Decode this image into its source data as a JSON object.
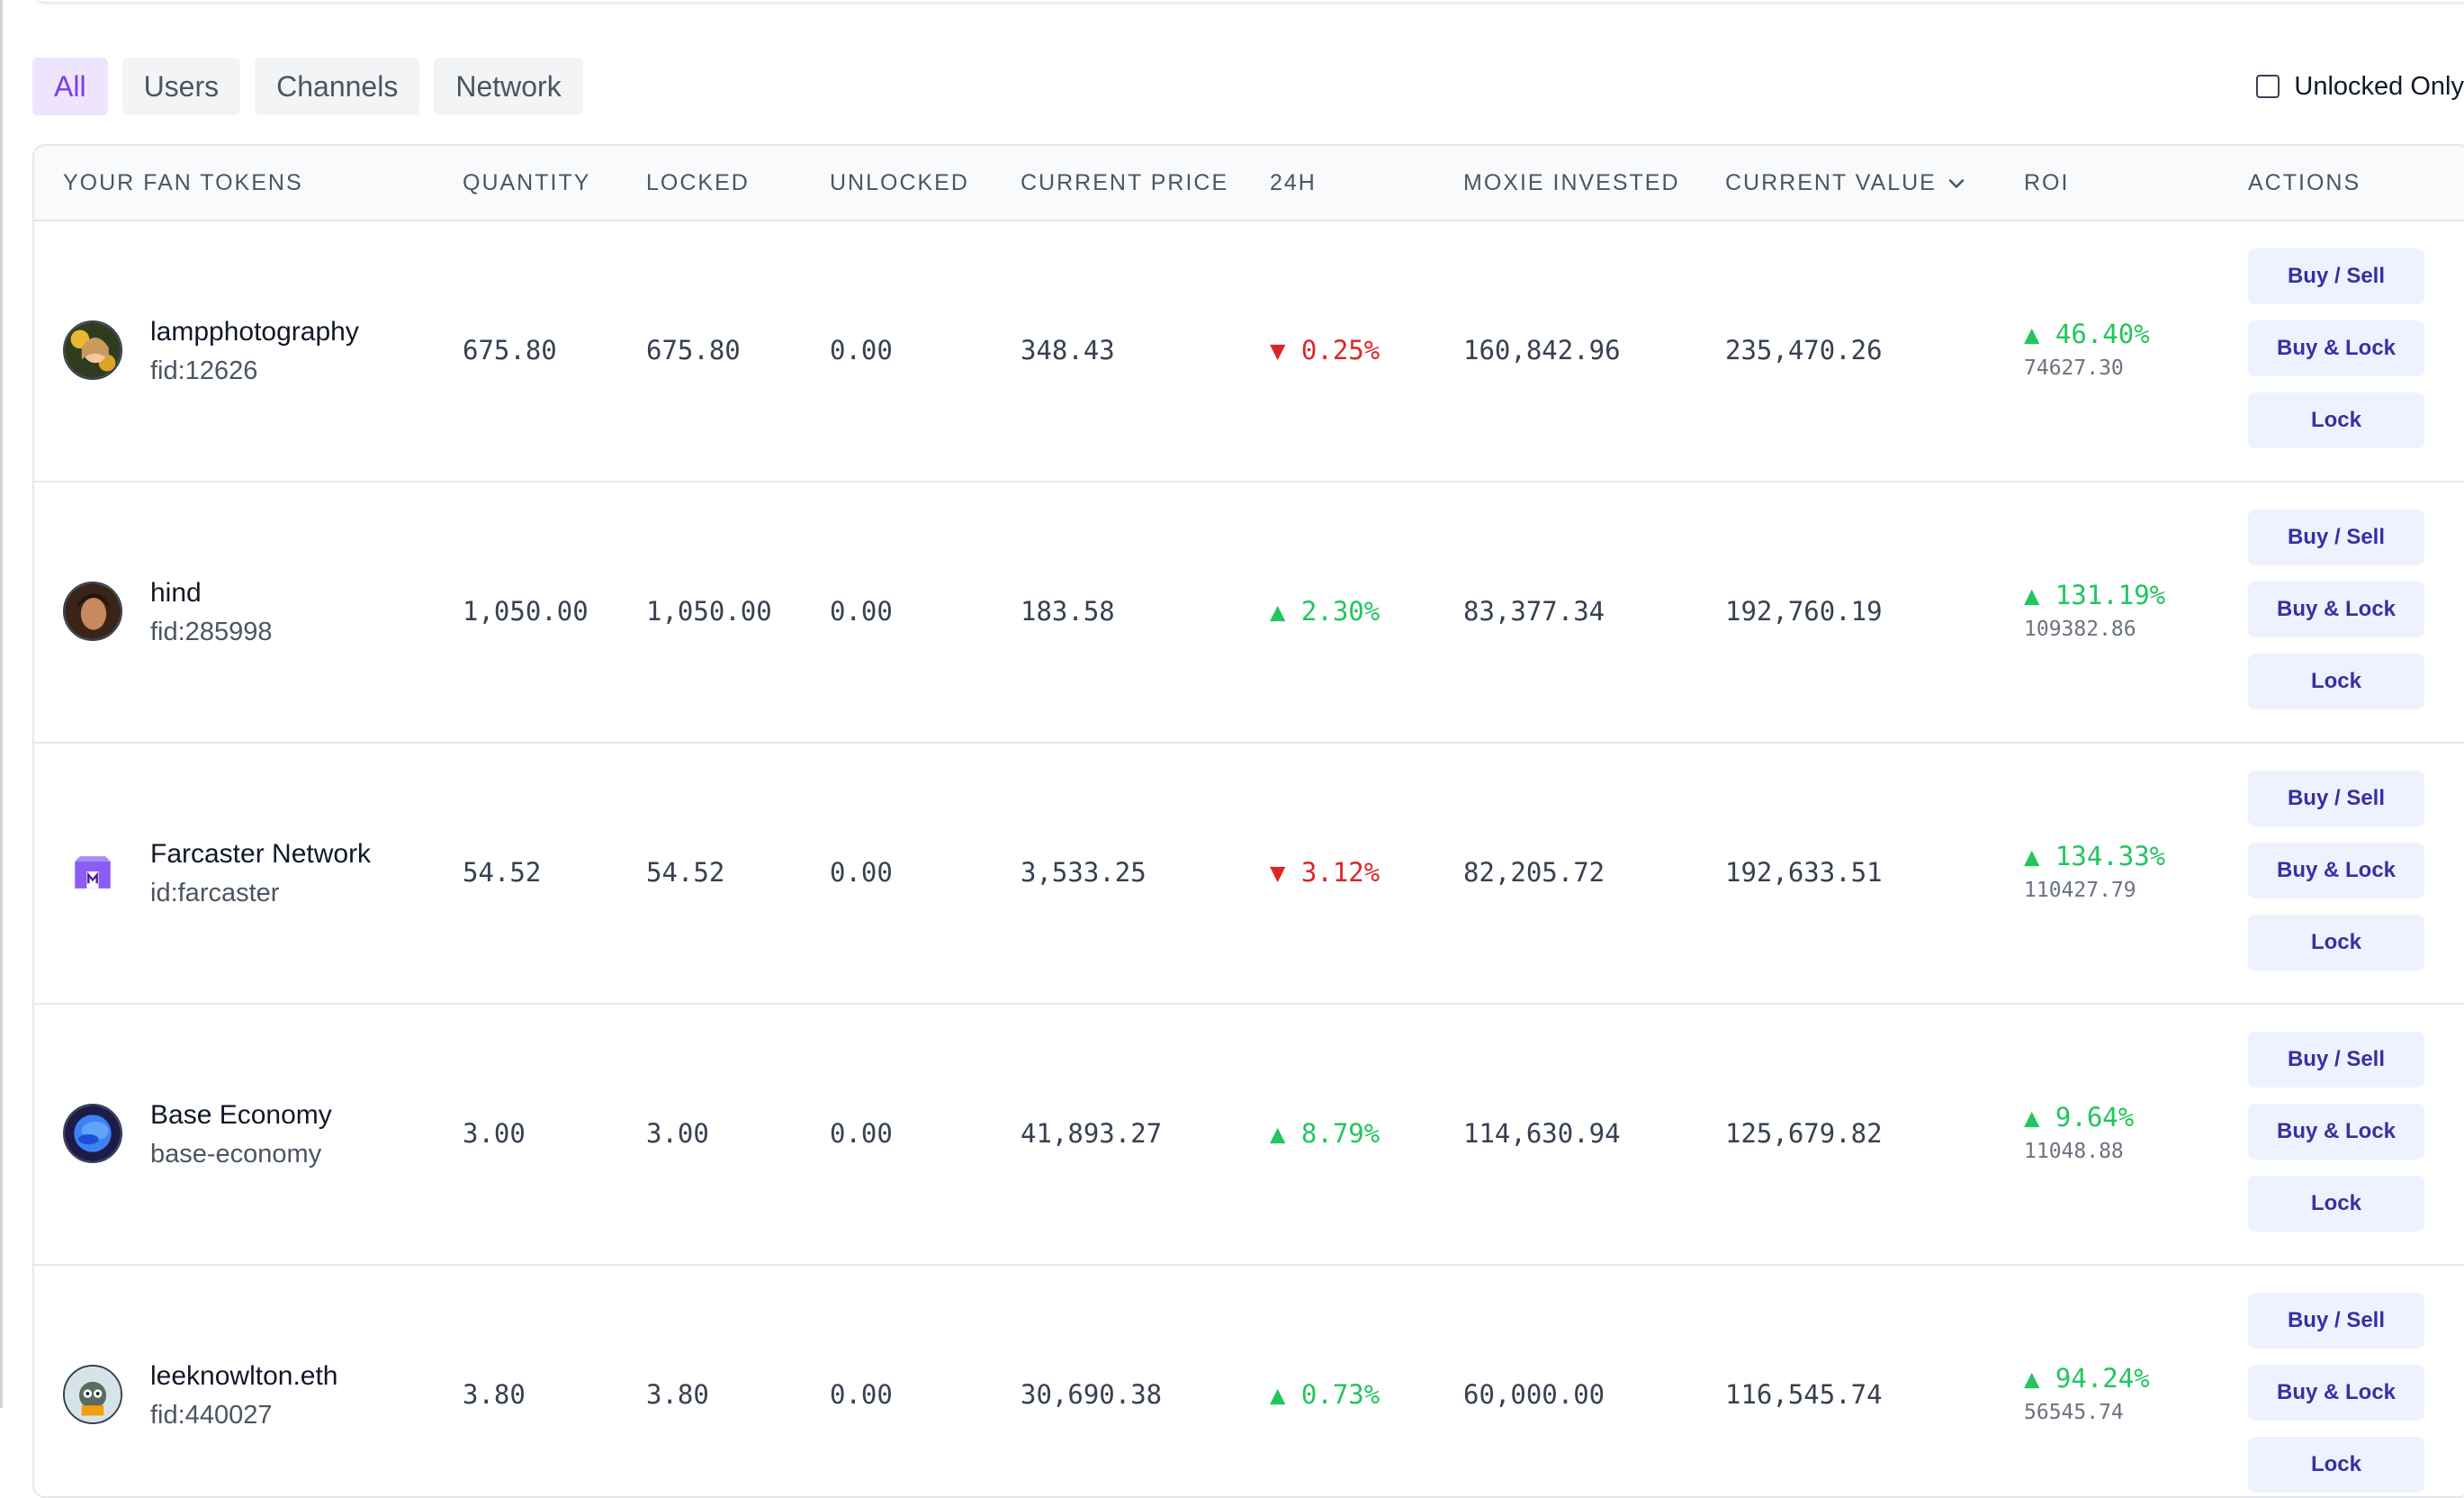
{
  "tabs": [
    "All",
    "Users",
    "Channels",
    "Network"
  ],
  "filter": {
    "unlocked_only_label": "Unlocked Only",
    "checked": false
  },
  "columns": {
    "token": "YOUR FAN TOKENS",
    "quantity": "QUANTITY",
    "locked": "LOCKED",
    "unlocked": "UNLOCKED",
    "current_price": "CURRENT PRICE",
    "change_24h": "24H",
    "moxie_invested": "MOXIE INVESTED",
    "current_value": "CURRENT VALUE",
    "roi": "ROI",
    "actions": "ACTIONS"
  },
  "sort_icon": "chevron-down-icon",
  "actions": {
    "buy_sell": "Buy / Sell",
    "buy_lock": "Buy & Lock",
    "lock": "Lock"
  },
  "colors": {
    "up": "#22c55e",
    "down": "#dc2626",
    "accent": "#7c3aed",
    "button_bg": "#eef2ff",
    "button_text": "#3730a3"
  },
  "rows": [
    {
      "name": "lampphotography",
      "id": "fid:12626",
      "quantity": "675.80",
      "locked": "675.80",
      "unlocked": "0.00",
      "price": "348.43",
      "change": "▼ 0.25%",
      "change_dir": "down",
      "invested": "160,842.96",
      "value": "235,470.26",
      "roi": "▲ 46.40%",
      "roi_amount": "74627.30"
    },
    {
      "name": "hind",
      "id": "fid:285998",
      "quantity": "1,050.00",
      "locked": "1,050.00",
      "unlocked": "0.00",
      "price": "183.58",
      "change": "▲ 2.30%",
      "change_dir": "up",
      "invested": "83,377.34",
      "value": "192,760.19",
      "roi": "▲ 131.19%",
      "roi_amount": "109382.86"
    },
    {
      "name": "Farcaster Network",
      "id": "id:farcaster",
      "quantity": "54.52",
      "locked": "54.52",
      "unlocked": "0.00",
      "price": "3,533.25",
      "change": "▼ 3.12%",
      "change_dir": "down",
      "invested": "82,205.72",
      "value": "192,633.51",
      "roi": "▲ 134.33%",
      "roi_amount": "110427.79"
    },
    {
      "name": "Base Economy",
      "id": "base-economy",
      "quantity": "3.00",
      "locked": "3.00",
      "unlocked": "0.00",
      "price": "41,893.27",
      "change": "▲ 8.79%",
      "change_dir": "up",
      "invested": "114,630.94",
      "value": "125,679.82",
      "roi": "▲ 9.64%",
      "roi_amount": "11048.88"
    },
    {
      "name": "leeknowlton.eth",
      "id": "fid:440027",
      "quantity": "3.80",
      "locked": "3.80",
      "unlocked": "0.00",
      "price": "30,690.38",
      "change": "▲ 0.73%",
      "change_dir": "up",
      "invested": "60,000.00",
      "value": "116,545.74",
      "roi": "▲ 94.24%",
      "roi_amount": "56545.74"
    }
  ]
}
